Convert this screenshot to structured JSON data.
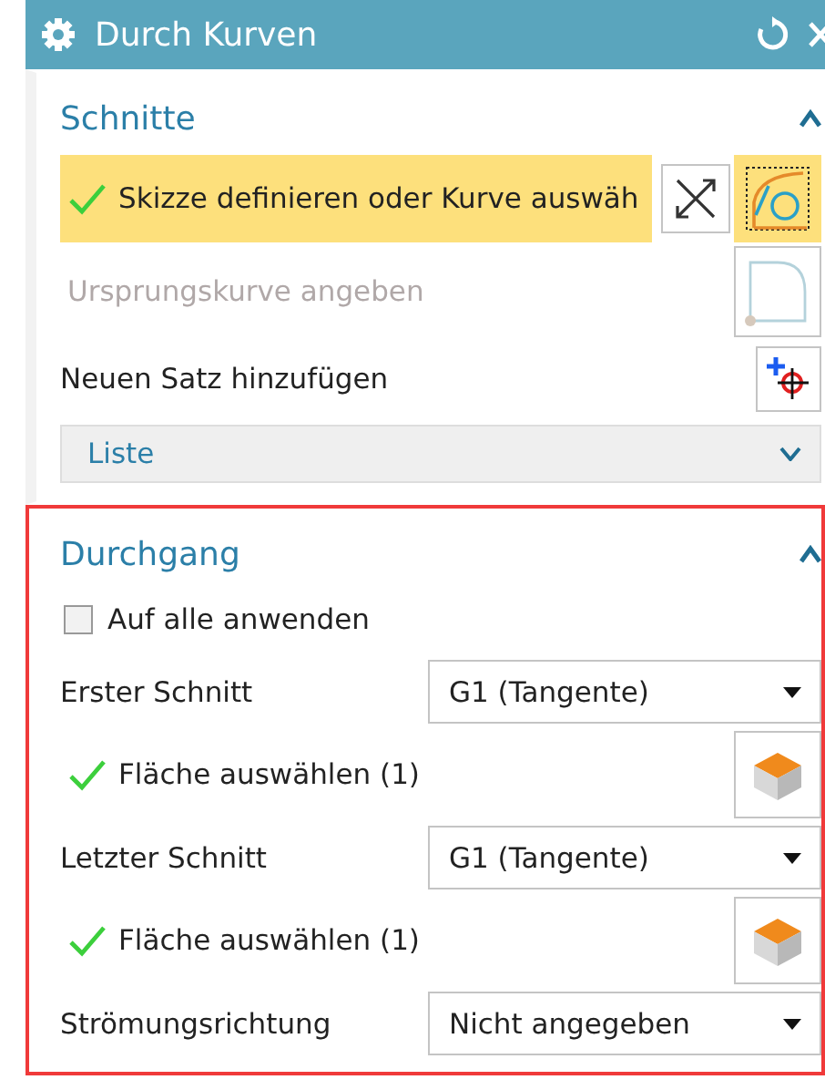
{
  "window": {
    "title": "Durch Kurven"
  },
  "sections": [
    {
      "title": "Schnitte",
      "expanded": true,
      "highlighted": false,
      "rows": [
        {
          "kind": "curve-select",
          "label": "Skizze definieren oder Kurve auswäh",
          "done": true,
          "active": true
        },
        {
          "kind": "origin-select",
          "label": "Ursprungskurve angeben",
          "disabled": true
        },
        {
          "kind": "add-set",
          "label": "Neuen Satz hinzufügen"
        },
        {
          "kind": "list",
          "label": "Liste",
          "expanded": false
        }
      ]
    },
    {
      "title": "Durchgang",
      "expanded": true,
      "highlighted": true,
      "rows": [
        {
          "kind": "checkbox",
          "label": "Auf alle anwenden",
          "checked": false
        },
        {
          "kind": "dropdown",
          "label": "Erster Schnitt",
          "value": "G1 (Tangente)"
        },
        {
          "kind": "face-select",
          "label": "Fläche auswählen (1)",
          "done": true
        },
        {
          "kind": "dropdown",
          "label": "Letzter Schnitt",
          "value": "G1 (Tangente)"
        },
        {
          "kind": "face-select",
          "label": "Fläche auswählen (1)",
          "done": true
        },
        {
          "kind": "dropdown",
          "label": "Strömungsrichtung",
          "value": "Nicht angegeben"
        }
      ]
    }
  ]
}
